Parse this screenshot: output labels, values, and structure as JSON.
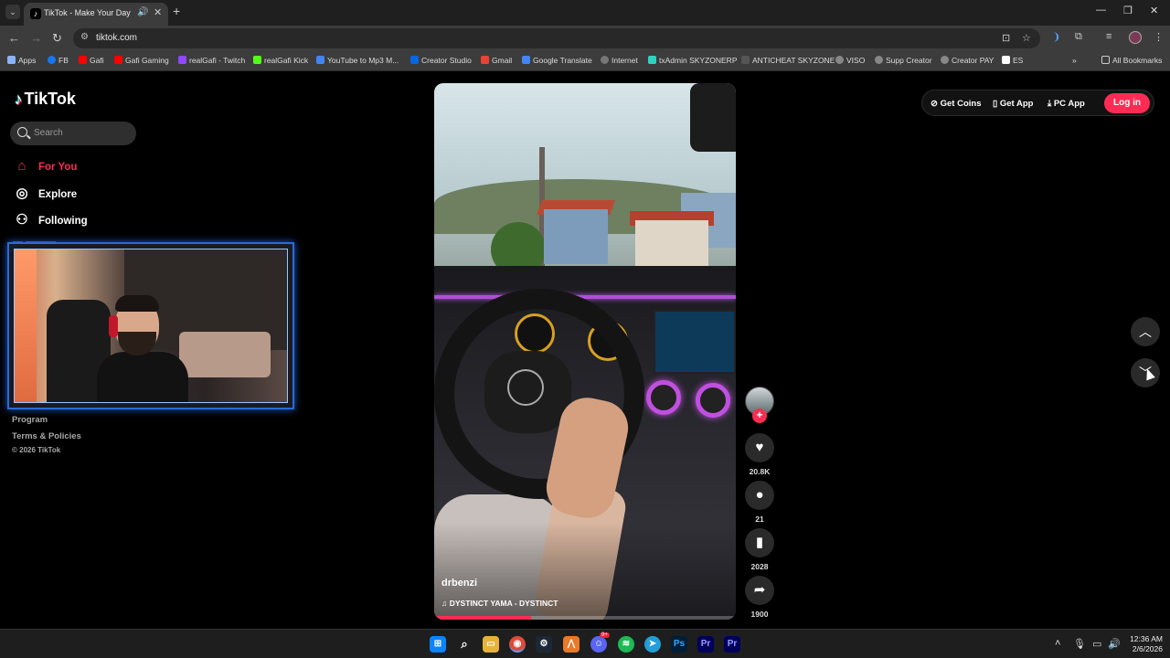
{
  "browser": {
    "tab_title": "TikTok - Make Your Day",
    "url": "tiktok.com",
    "window_controls": {
      "minimize": "—",
      "restore": "❐",
      "close": "✕"
    }
  },
  "bookmarks": [
    "Apps",
    "FB",
    "Gafi",
    "Gafi Gaming",
    "realGafi - Twitch",
    "realGafi Kick",
    "YouTube to Mp3 M...",
    "Creator Studio",
    "Gmail",
    "Google Translate",
    "Internet",
    "txAdmin SKYZONERP",
    "ANTICHEAT SKYZONE",
    "VISO",
    "Supp Creator",
    "Creator PAY",
    "ES",
    "All Bookmarks"
  ],
  "tiktok": {
    "logo": "TikTok",
    "search_placeholder": "Search",
    "nav": [
      {
        "label": "For You",
        "icon": "home-icon",
        "active": true
      },
      {
        "label": "Explore",
        "icon": "compass-icon",
        "active": false
      },
      {
        "label": "Following",
        "icon": "following-icon",
        "active": false
      }
    ],
    "footer": [
      "Program",
      "Terms & Policies"
    ],
    "copyright": "© 2026 TikTok",
    "top_actions": {
      "coins": "Get Coins",
      "app": "Get App",
      "pc": "PC App",
      "login": "Log in"
    },
    "video": {
      "author": "drbenzi",
      "music": "DYSTINCT YAMA - DYSTINCT",
      "progress": 0.32
    },
    "actions": {
      "likes": "20.8K",
      "comments": "21",
      "saves": "2028",
      "shares": "1900"
    }
  },
  "taskbar": {
    "time": "12:36 AM",
    "date": "2/6/2026",
    "discord_badge": "9+"
  },
  "colors": {
    "accent": "#fe2c55",
    "webcam_border": "#2a6bd8"
  }
}
